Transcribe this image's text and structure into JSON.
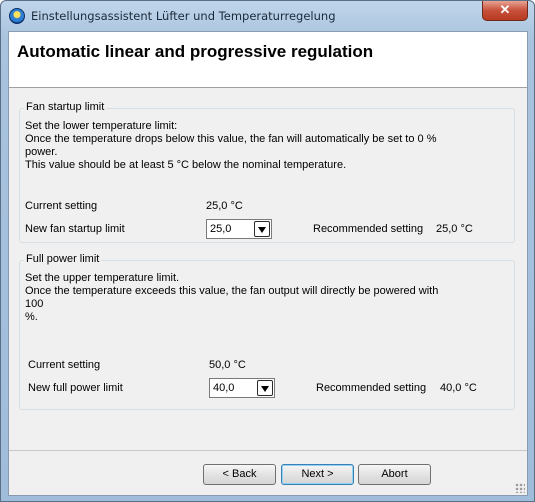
{
  "window": {
    "title": "Einstellungsassistent Lüfter und Temperaturregelung",
    "close_glyph": "✕"
  },
  "header": {
    "title": "Automatic linear and progressive regulation"
  },
  "startup_group": {
    "legend": "Fan startup limit",
    "description": "Set the lower temperature limit:\nOnce the temperature drops below this value, the fan will automatically be set to 0 % power.\nThis value should be at least 5 °C below the nominal temperature.",
    "current_label": "Current setting",
    "current_value": "25,0 °C",
    "new_label": "New fan startup limit",
    "new_value": "25,0",
    "recommended_label": "Recommended setting",
    "recommended_value": "25,0 °C"
  },
  "fullpower_group": {
    "legend": "Full power limit",
    "description": "Set the upper temperature limit.\nOnce the temperature exceeds this value, the fan output will directly be powered with 100\n%.",
    "current_label": "Current setting",
    "current_value": "50,0 °C",
    "new_label": "New full power limit",
    "new_value": "40,0",
    "recommended_label": "Recommended setting",
    "recommended_value": "40,0 °C"
  },
  "footer": {
    "back_label": "< Back",
    "next_label": "Next >",
    "abort_label": "Abort"
  }
}
